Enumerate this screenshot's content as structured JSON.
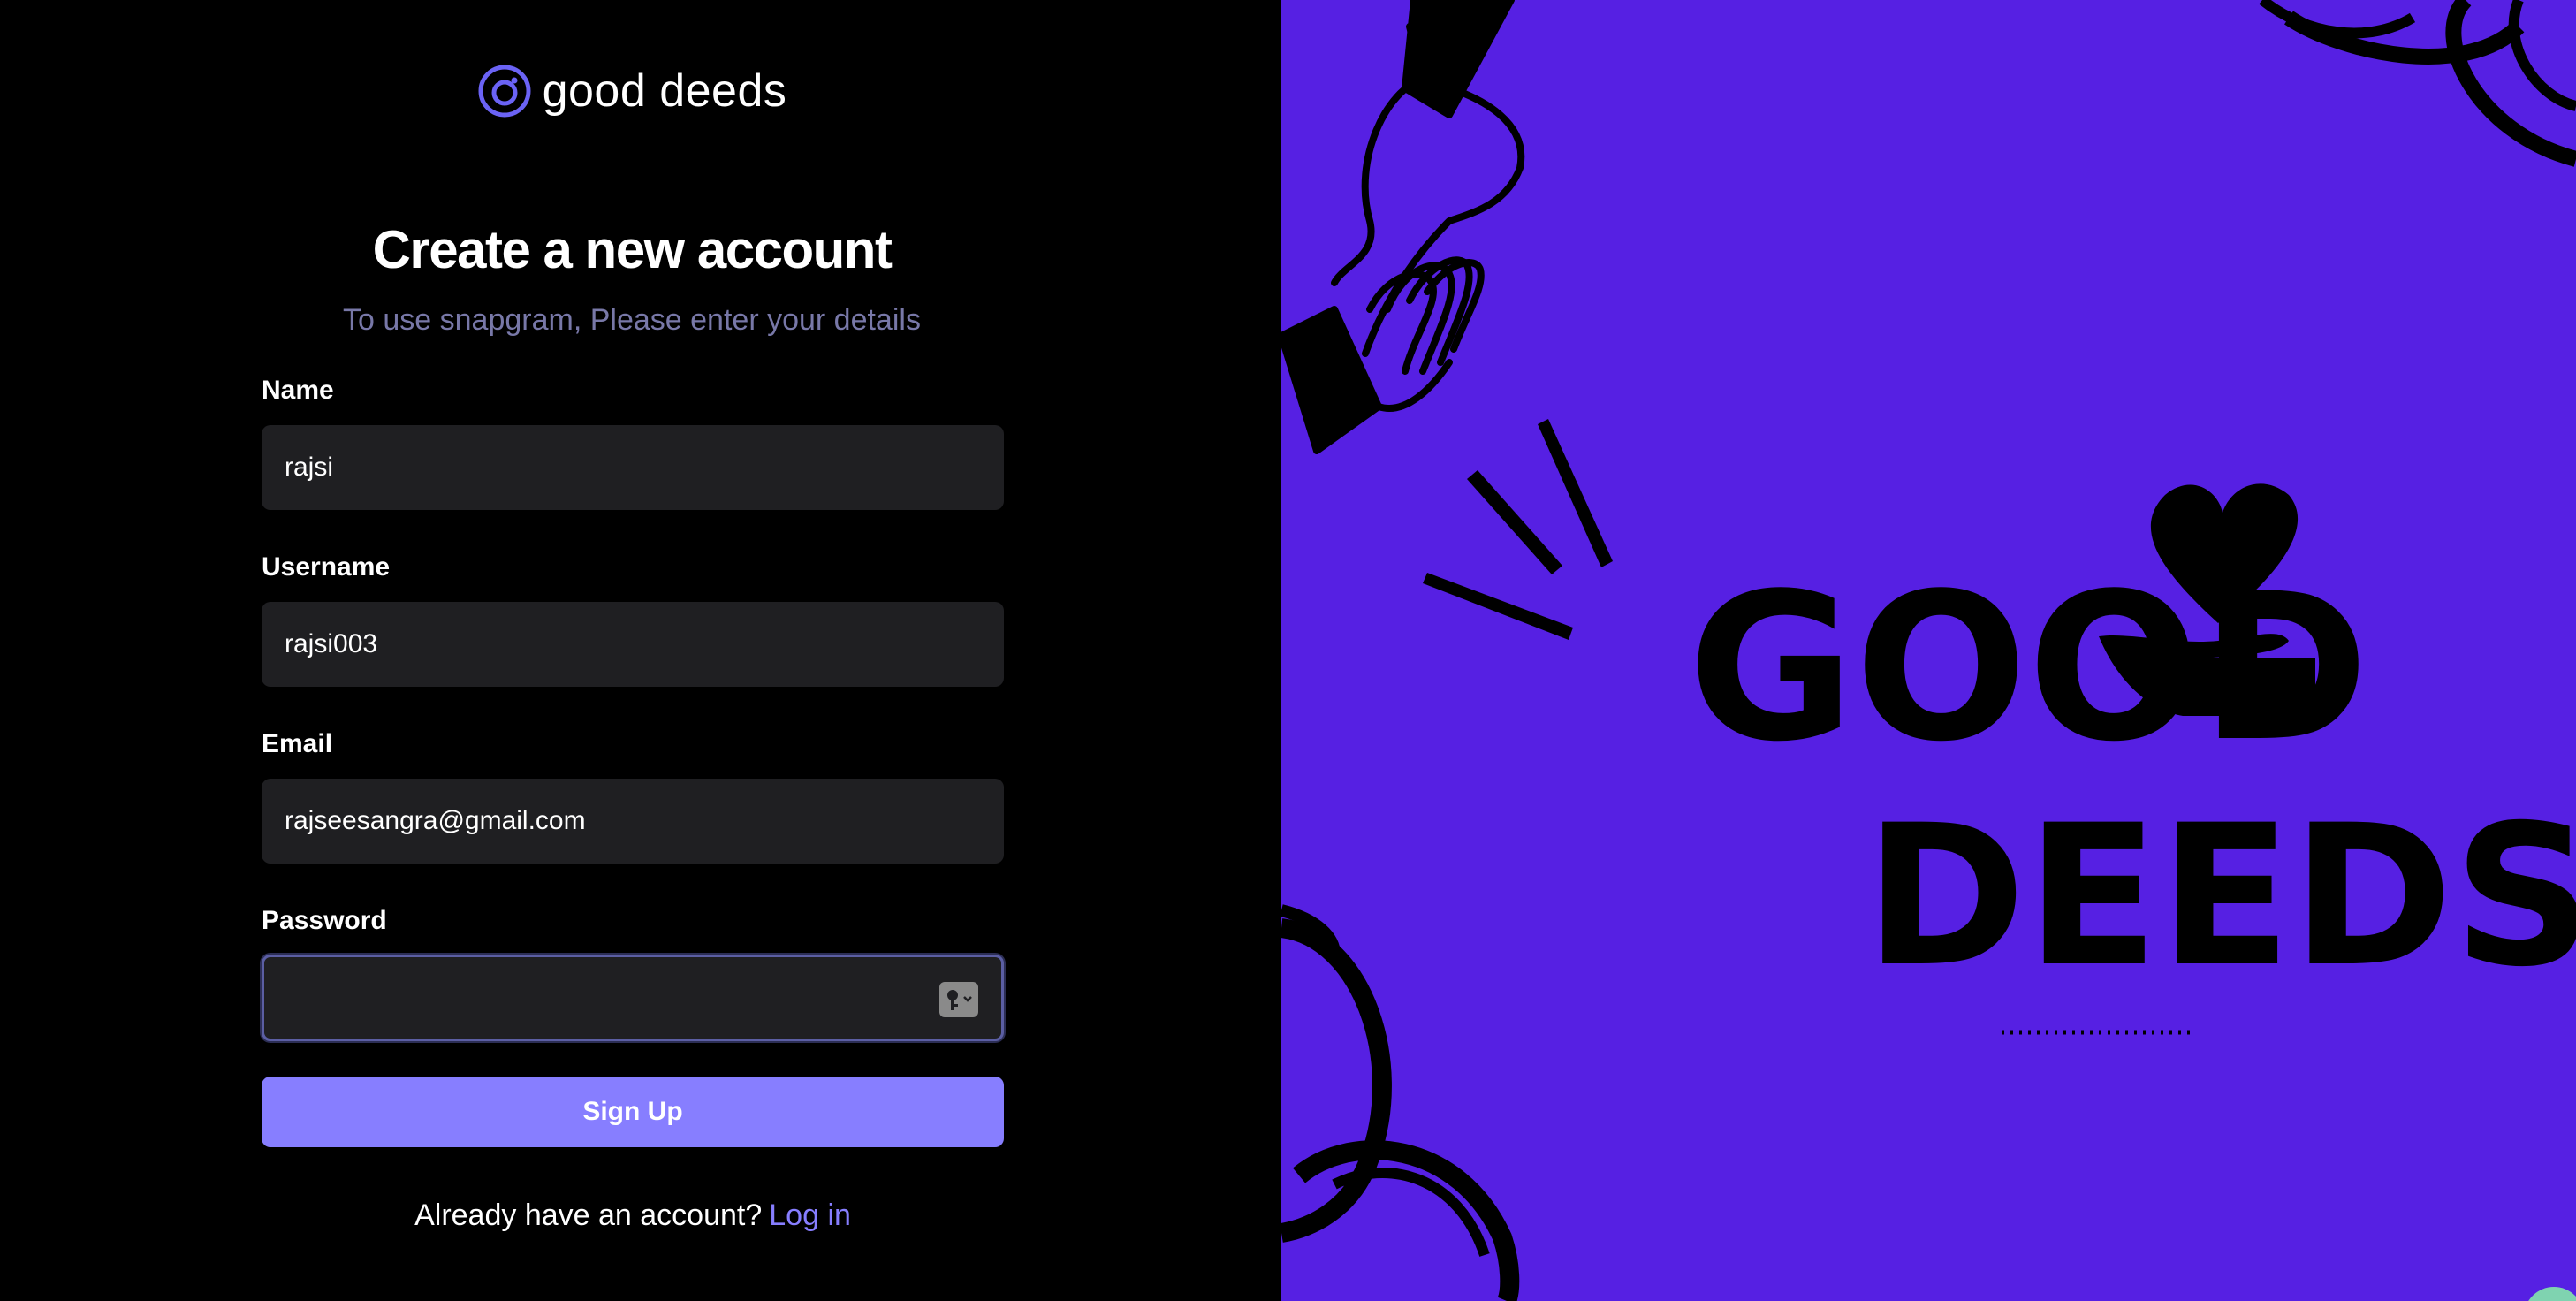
{
  "brand": {
    "name": "good deeds",
    "icon": "logo-ring-icon",
    "accent": "#877eff"
  },
  "header": {
    "title": "Create a new account",
    "subtitle": "To use snapgram, Please enter your details"
  },
  "form": {
    "name": {
      "label": "Name",
      "value": "rajsi"
    },
    "username": {
      "label": "Username",
      "value": "rajsi003"
    },
    "email": {
      "label": "Email",
      "value": "rajseesangra@gmail.com"
    },
    "password": {
      "label": "Password",
      "value": "",
      "icon": "password-key-icon"
    },
    "submit_label": "Sign Up"
  },
  "footer": {
    "prompt": "Already have an account?",
    "login_label": "Log in"
  },
  "illustration": {
    "background": "#5620e3",
    "line1": "GOOD",
    "line2": "DEEDS"
  }
}
